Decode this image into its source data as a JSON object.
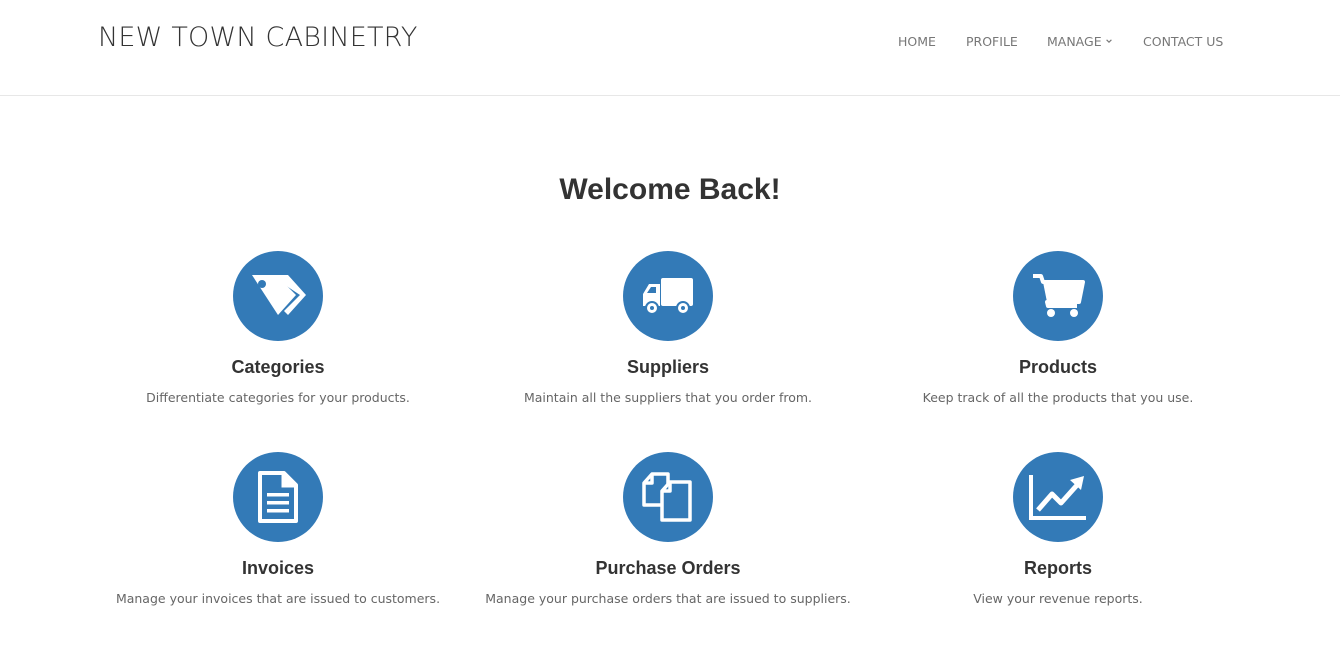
{
  "header": {
    "brand": "NEW TOWN CABINETRY",
    "nav": {
      "home": "HOME",
      "profile": "PROFILE",
      "manage": "MANAGE",
      "contact": "CONTACT US"
    }
  },
  "main": {
    "heading": "Welcome Back!",
    "cards": [
      {
        "title": "Categories",
        "description": "Differentiate categories for your products.",
        "icon": "tags-icon"
      },
      {
        "title": "Suppliers",
        "description": "Maintain all the suppliers that you order from.",
        "icon": "truck-icon"
      },
      {
        "title": "Products",
        "description": "Keep track of all the products that you use.",
        "icon": "shopping-cart-icon"
      },
      {
        "title": "Invoices",
        "description": "Manage your invoices that are issued to customers.",
        "icon": "document-icon"
      },
      {
        "title": "Purchase Orders",
        "description": "Manage your purchase orders that are issued to suppliers.",
        "icon": "copy-documents-icon"
      },
      {
        "title": "Reports",
        "description": "View your revenue reports.",
        "icon": "line-chart-icon"
      }
    ]
  },
  "colors": {
    "accent": "#337ab7",
    "text": "#333333",
    "nav_text": "#777777",
    "muted": "#666666"
  }
}
